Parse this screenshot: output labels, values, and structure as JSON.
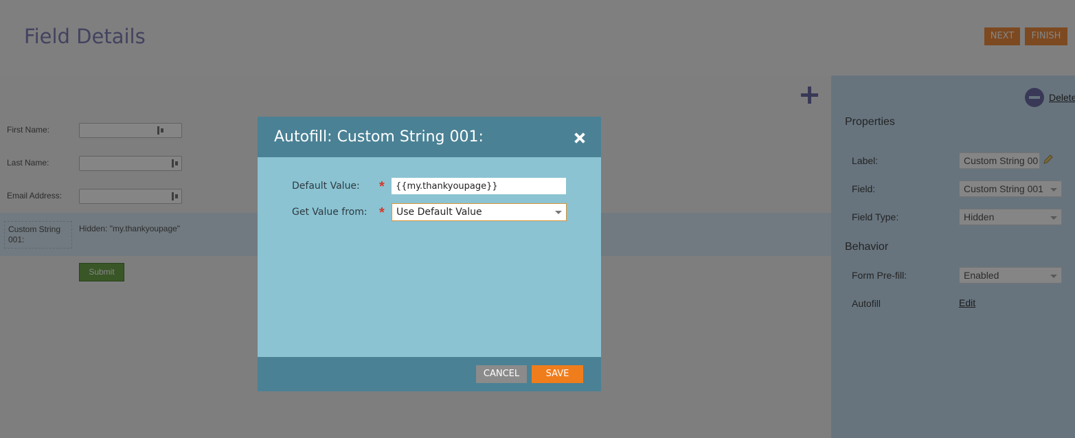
{
  "header": {
    "title": "Field Details",
    "next_label": "NEXT",
    "finish_label": "FINISH"
  },
  "form": {
    "fields": [
      {
        "label": "First Name:"
      },
      {
        "label": "Last Name:"
      },
      {
        "label": "Email Address:"
      }
    ],
    "custom_field": {
      "label": "Custom String 001:",
      "preview": "Hidden: \"my.thankyoupage\""
    },
    "submit_label": "Submit"
  },
  "properties_panel": {
    "delete_label": "Delete",
    "properties_title": "Properties",
    "label_label": "Label:",
    "label_value": "Custom String 00",
    "field_label": "Field:",
    "field_value": "Custom String 001",
    "field_type_label": "Field Type:",
    "field_type_value": "Hidden",
    "behavior_title": "Behavior",
    "prefill_label": "Form Pre-fill:",
    "prefill_value": "Enabled",
    "autofill_label": "Autofill",
    "edit_label": "Edit"
  },
  "modal": {
    "title": "Autofill: Custom String 001:",
    "default_value_label": "Default Value:",
    "default_value": "{{my.thankyoupage}}",
    "get_value_label": "Get Value from:",
    "get_value_selected": "Use Default Value",
    "required_mark": "*",
    "cancel_label": "CANCEL",
    "save_label": "SAVE"
  },
  "colors": {
    "accent_orange": "#f07d1c",
    "modal_header": "#4a8195",
    "modal_body": "#8bc3d2",
    "title_purple": "#7f7fb8"
  },
  "icons": [
    "plus-icon",
    "delete-icon",
    "pencil-icon",
    "close-icon",
    "field-handle-icon",
    "dropdown-arrow-icon"
  ]
}
